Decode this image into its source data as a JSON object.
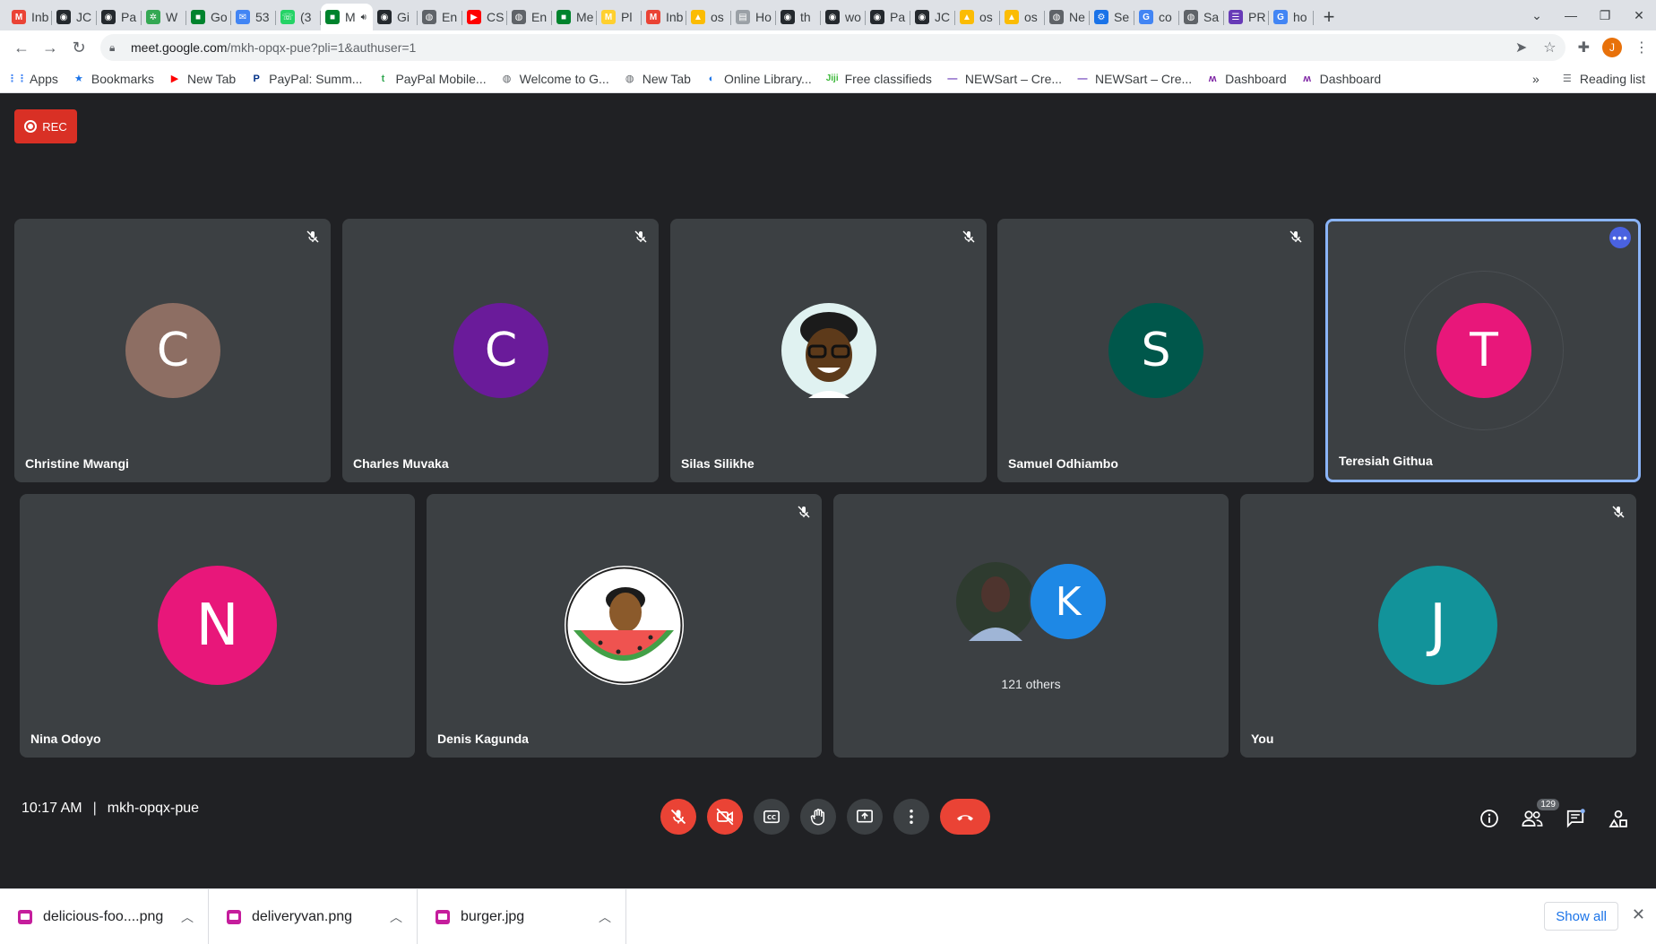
{
  "browser": {
    "tabs": [
      {
        "label": "Inb",
        "icon": "gmail-icon",
        "color": "#ea4335",
        "glyph": "M"
      },
      {
        "label": "JC",
        "icon": "github-icon",
        "color": "#24292e",
        "glyph": "◉"
      },
      {
        "label": "Pa",
        "icon": "github-icon",
        "color": "#24292e",
        "glyph": "◉"
      },
      {
        "label": "W",
        "icon": "palm-icon",
        "color": "#34a853",
        "glyph": "✲"
      },
      {
        "label": "Go",
        "icon": "meet-icon",
        "color": "#00832d",
        "glyph": "■"
      },
      {
        "label": "53",
        "icon": "mail-icon",
        "color": "#4285f4",
        "glyph": "✉"
      },
      {
        "label": "(3",
        "icon": "whatsapp-icon",
        "color": "#25d366",
        "glyph": "☏"
      },
      {
        "label": "M",
        "icon": "meet-icon",
        "color": "#00832d",
        "glyph": "■",
        "active": true
      },
      {
        "label": "Gi",
        "icon": "github-icon",
        "color": "#24292e",
        "glyph": "◉"
      },
      {
        "label": "En",
        "icon": "globe-icon",
        "color": "#5f6368",
        "glyph": "◍"
      },
      {
        "label": "CS",
        "icon": "youtube-icon",
        "color": "#ff0000",
        "glyph": "▶"
      },
      {
        "label": "En",
        "icon": "globe-icon",
        "color": "#5f6368",
        "glyph": "◍"
      },
      {
        "label": "Me",
        "icon": "meet-icon",
        "color": "#00832d",
        "glyph": "■"
      },
      {
        "label": "Pl",
        "icon": "miro-icon",
        "color": "#ffd02f",
        "glyph": "M"
      },
      {
        "label": "Inb",
        "icon": "gmail-icon",
        "color": "#ea4335",
        "glyph": "M"
      },
      {
        "label": "os",
        "icon": "drive-icon",
        "color": "#fbbc04",
        "glyph": "▲"
      },
      {
        "label": "Ho",
        "icon": "bank-icon",
        "color": "#9aa0a6",
        "glyph": "▤"
      },
      {
        "label": "th",
        "icon": "github-icon",
        "color": "#24292e",
        "glyph": "◉"
      },
      {
        "label": "wo",
        "icon": "github-icon",
        "color": "#24292e",
        "glyph": "◉"
      },
      {
        "label": "Pa",
        "icon": "github-icon",
        "color": "#24292e",
        "glyph": "◉"
      },
      {
        "label": "JC",
        "icon": "github-icon",
        "color": "#24292e",
        "glyph": "◉"
      },
      {
        "label": "os",
        "icon": "drive-icon",
        "color": "#fbbc04",
        "glyph": "▲"
      },
      {
        "label": "os",
        "icon": "drive-icon",
        "color": "#fbbc04",
        "glyph": "▲"
      },
      {
        "label": "Ne",
        "icon": "globe-icon",
        "color": "#5f6368",
        "glyph": "◍"
      },
      {
        "label": "Se",
        "icon": "gear-icon",
        "color": "#1a73e8",
        "glyph": "⚙"
      },
      {
        "label": "co",
        "icon": "google-icon",
        "color": "#4285f4",
        "glyph": "G"
      },
      {
        "label": "Sa",
        "icon": "globe-icon",
        "color": "#5f6368",
        "glyph": "◍"
      },
      {
        "label": "PR",
        "icon": "doc-icon",
        "color": "#673ab7",
        "glyph": "☰"
      },
      {
        "label": "ho",
        "icon": "google-icon",
        "color": "#4285f4",
        "glyph": "G"
      }
    ],
    "url_host": "meet.google.com",
    "url_path": "/mkh-opqx-pue?pli=1&authuser=1",
    "profile_initial": "J",
    "bookmarks": [
      {
        "label": "Apps",
        "icon": "apps-grid-icon",
        "glyph": "⋮⋮",
        "color": "#4285f4"
      },
      {
        "label": "Bookmarks",
        "icon": "star-icon",
        "glyph": "★",
        "color": "#1a73e8"
      },
      {
        "label": "New Tab",
        "icon": "youtube-icon",
        "glyph": "▶",
        "color": "#ff0000"
      },
      {
        "label": "PayPal: Summ...",
        "icon": "paypal-icon",
        "glyph": "P",
        "color": "#003087"
      },
      {
        "label": "PayPal Mobile...",
        "icon": "tumblr-icon",
        "glyph": "t",
        "color": "#34a853"
      },
      {
        "label": "Welcome to G...",
        "icon": "globe-icon",
        "glyph": "◍",
        "color": "#5f6368"
      },
      {
        "label": "New Tab",
        "icon": "globe-icon",
        "glyph": "◍",
        "color": "#5f6368"
      },
      {
        "label": "Online Library...",
        "icon": "library-icon",
        "glyph": "◐",
        "color": "#1a73e8"
      },
      {
        "label": "Free classifieds",
        "icon": "jiji-icon",
        "glyph": "Jiji",
        "color": "#3db83a"
      },
      {
        "label": "NEWSart – Cre...",
        "icon": "newsart-icon",
        "glyph": "—",
        "color": "#673ab7"
      },
      {
        "label": "NEWSart – Cre...",
        "icon": "newsart-icon",
        "glyph": "—",
        "color": "#673ab7"
      },
      {
        "label": "Dashboard",
        "icon": "dashboard-icon",
        "glyph": "ʍ",
        "color": "#7b1fa2"
      },
      {
        "label": "Dashboard",
        "icon": "dashboard-icon",
        "glyph": "ʍ",
        "color": "#7b1fa2"
      }
    ],
    "bookmarks_overflow": "»",
    "reading_list": "Reading list"
  },
  "meet": {
    "rec_label": "REC",
    "tiles_row1": [
      {
        "name": "Christine Mwangi",
        "initial": "C",
        "color": "#8d6e63",
        "muted": true
      },
      {
        "name": "Charles Muvaka",
        "initial": "C",
        "color": "#6a1b9a",
        "muted": true
      },
      {
        "name": "Silas Silikhe",
        "initial": "",
        "color": "#e0f2f1",
        "muted": true,
        "photo": "memoji"
      },
      {
        "name": "Samuel Odhiambo",
        "initial": "S",
        "color": "#00574b",
        "muted": true
      },
      {
        "name": "Teresiah Githua",
        "initial": "T",
        "color": "#e8177a",
        "muted": false,
        "pinned": true
      }
    ],
    "tiles_row2": [
      {
        "name": "Nina Odoyo",
        "initial": "N",
        "color": "#e8177a",
        "muted": false
      },
      {
        "name": "Denis Kagunda",
        "initial": "",
        "color": "#ffffff",
        "muted": true,
        "photo": "watermelon"
      },
      {
        "name": "",
        "initial": "K",
        "color": "#1e88e5",
        "muted": false,
        "others": "121 others"
      },
      {
        "name": "You",
        "initial": "J",
        "color": "#12939a",
        "muted": true
      }
    ],
    "time": "10:17 AM",
    "meeting_code": "mkh-opqx-pue",
    "people_count": "129"
  },
  "downloads": {
    "items": [
      {
        "name": "delicious-foo....png"
      },
      {
        "name": "deliveryvan.png"
      },
      {
        "name": "burger.jpg"
      }
    ],
    "show_all": "Show all"
  }
}
